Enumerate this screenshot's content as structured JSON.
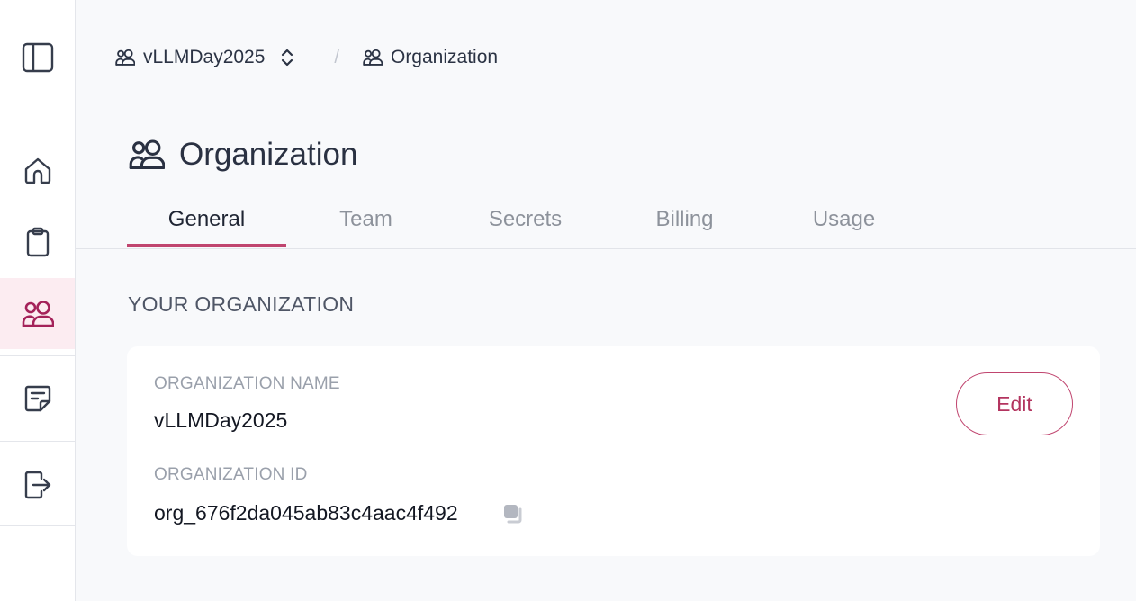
{
  "sidebar": {
    "items": [
      {
        "icon": "sidebar-toggle-icon"
      },
      {
        "icon": "home-icon"
      },
      {
        "icon": "clipboard-icon"
      },
      {
        "icon": "users-icon",
        "active": true
      },
      {
        "icon": "notes-icon"
      },
      {
        "icon": "logout-icon"
      }
    ],
    "active_color": "#a4225a",
    "active_bg": "#fcecf1"
  },
  "breadcrumb": {
    "workspace": "vLLMDay2025",
    "separator": "/",
    "current": "Organization"
  },
  "page": {
    "title": "Organization"
  },
  "tabs": [
    {
      "label": "General",
      "active": true
    },
    {
      "label": "Team"
    },
    {
      "label": "Secrets"
    },
    {
      "label": "Billing"
    },
    {
      "label": "Usage"
    }
  ],
  "section": {
    "title": "YOUR ORGANIZATION"
  },
  "organization": {
    "name_label": "ORGANIZATION NAME",
    "name": "vLLMDay2025",
    "id_label": "ORGANIZATION ID",
    "id": "org_676f2da045ab83c4aac4f492",
    "edit_label": "Edit"
  },
  "accent_color": "#c0456f"
}
